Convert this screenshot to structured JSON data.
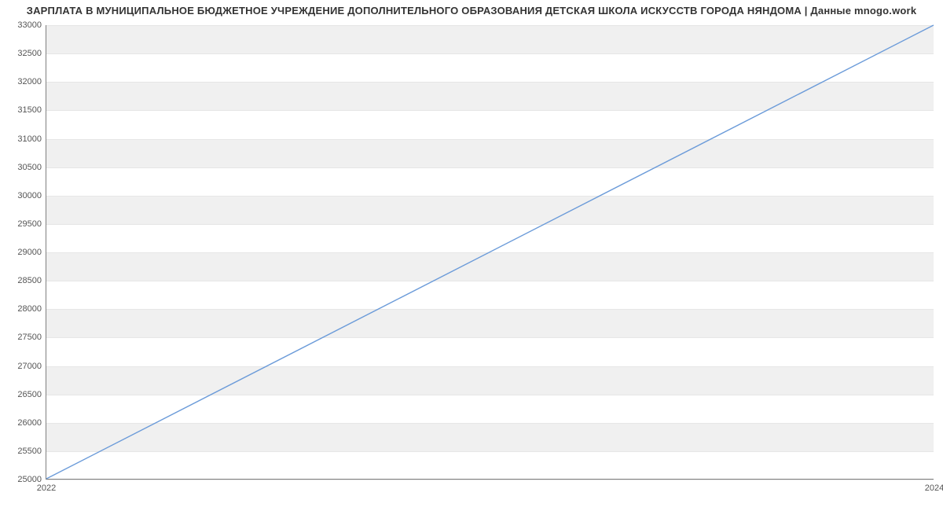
{
  "chart_data": {
    "type": "line",
    "title": "ЗАРПЛАТА В МУНИЦИПАЛЬНОЕ БЮДЖЕТНОЕ УЧРЕЖДЕНИЕ ДОПОЛНИТЕЛЬНОГО ОБРАЗОВАНИЯ ДЕТСКАЯ ШКОЛА ИСКУССТВ ГОРОДА НЯНДОМА | Данные mnogo.work",
    "x": [
      2022,
      2024
    ],
    "values": [
      25000,
      33000
    ],
    "xlabel": "",
    "ylabel": "",
    "xlim": [
      2022,
      2024
    ],
    "ylim": [
      25000,
      33000
    ],
    "yticks": [
      25000,
      25500,
      26000,
      26500,
      27000,
      27500,
      28000,
      28500,
      29000,
      29500,
      30000,
      30500,
      31000,
      31500,
      32000,
      32500,
      33000
    ],
    "xticks": [
      2022,
      2024
    ],
    "line_color": "#6b9bd9",
    "band_color": "#f0f0f0"
  }
}
